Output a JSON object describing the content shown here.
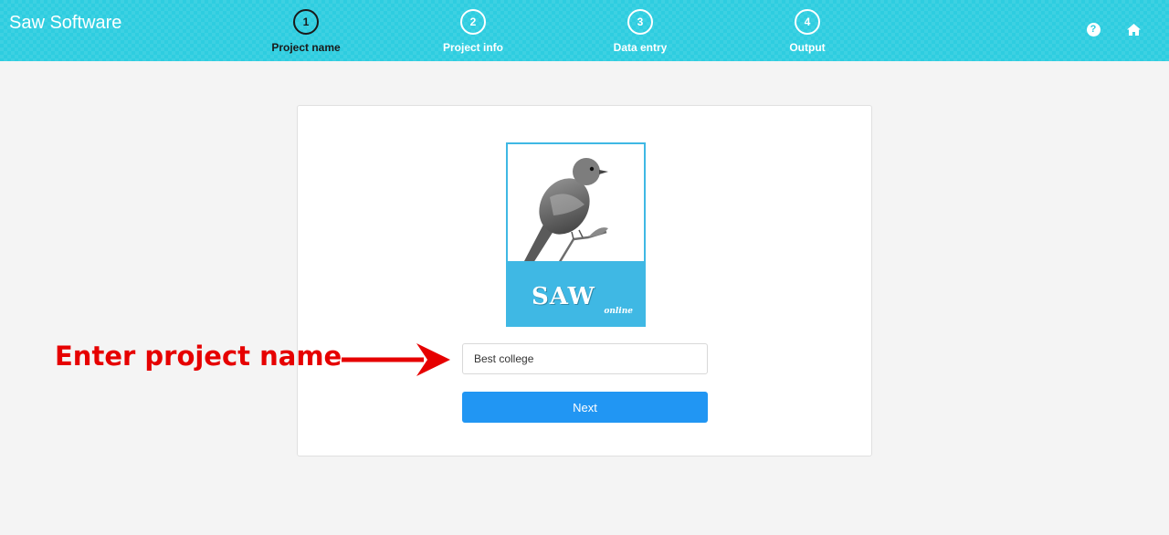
{
  "header": {
    "brand": "Saw Software",
    "steps": [
      {
        "number": "1",
        "label": "Project name",
        "active": true
      },
      {
        "number": "2",
        "label": "Project info",
        "active": false
      },
      {
        "number": "3",
        "label": "Data entry",
        "active": false
      },
      {
        "number": "4",
        "label": "Output",
        "active": false
      }
    ],
    "help_icon": "question-circle-icon",
    "home_icon": "home-icon",
    "help_glyph": "?"
  },
  "colors": {
    "header_bg": "#2ecde0",
    "logo_blue": "#3fb8e4",
    "button_blue": "#2196f3",
    "annotation_red": "#e60000"
  },
  "logo": {
    "title": "SAW",
    "subtitle": "online"
  },
  "form": {
    "project_name_value": "Best college",
    "next_label": "Next"
  },
  "annotation": {
    "text": "Enter project name"
  }
}
